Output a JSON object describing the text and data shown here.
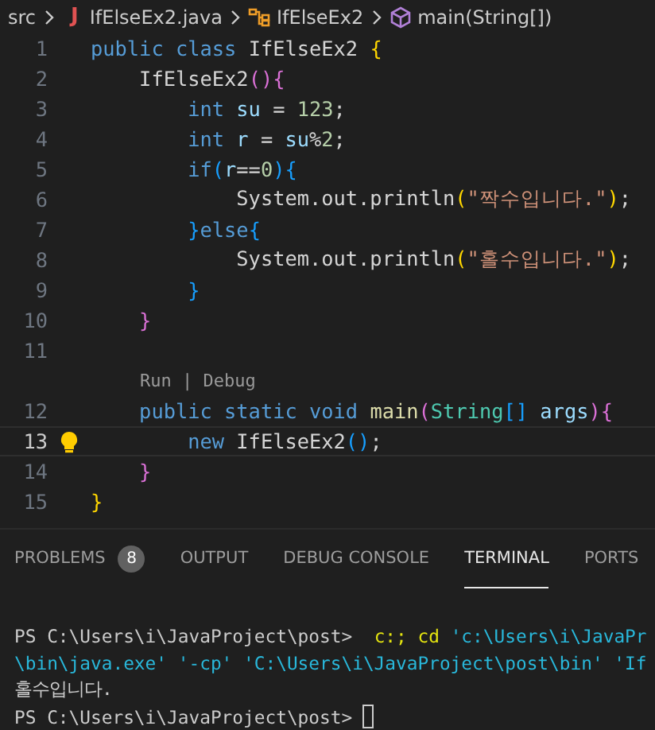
{
  "breadcrumb": {
    "folder": "src",
    "file_icon": "J",
    "file": "IfElseEx2.java",
    "class": "IfElseEx2",
    "method": "main(String[])"
  },
  "editor": {
    "lines": [
      {
        "number": "1",
        "current": false,
        "tokens": [
          {
            "text": "public",
            "kind": "kw"
          },
          {
            "text": " class",
            "kind": "kw"
          },
          {
            "text": " IfElseEx2 ",
            "kind": "plain"
          },
          {
            "text": "{",
            "kind": "b1"
          }
        ]
      },
      {
        "number": "2",
        "current": false,
        "tokens": [
          {
            "text": "    IfElseEx2",
            "kind": "plain"
          },
          {
            "text": "()",
            "kind": "b2"
          },
          {
            "text": "{",
            "kind": "b2"
          }
        ]
      },
      {
        "number": "3",
        "current": false,
        "tokens": [
          {
            "text": "        int",
            "kind": "kw"
          },
          {
            "text": " su ",
            "kind": "ident"
          },
          {
            "text": "= ",
            "kind": "plain"
          },
          {
            "text": "123",
            "kind": "num"
          },
          {
            "text": ";",
            "kind": "plain"
          }
        ]
      },
      {
        "number": "4",
        "current": false,
        "tokens": [
          {
            "text": "        int",
            "kind": "kw"
          },
          {
            "text": " r ",
            "kind": "ident"
          },
          {
            "text": "= ",
            "kind": "plain"
          },
          {
            "text": "su",
            "kind": "ident"
          },
          {
            "text": "%",
            "kind": "plain"
          },
          {
            "text": "2",
            "kind": "num"
          },
          {
            "text": ";",
            "kind": "plain"
          }
        ]
      },
      {
        "number": "5",
        "current": false,
        "tokens": [
          {
            "text": "        if",
            "kind": "kw"
          },
          {
            "text": "(",
            "kind": "b3"
          },
          {
            "text": "r",
            "kind": "ident"
          },
          {
            "text": "==",
            "kind": "plain"
          },
          {
            "text": "0",
            "kind": "num"
          },
          {
            "text": "){",
            "kind": "b3"
          }
        ]
      },
      {
        "number": "6",
        "current": false,
        "tokens": [
          {
            "text": "            System.out.println",
            "kind": "plain"
          },
          {
            "text": "(",
            "kind": "b1"
          },
          {
            "text": "\"짝수입니다.\"",
            "kind": "str"
          },
          {
            "text": ")",
            "kind": "b1"
          },
          {
            "text": ";",
            "kind": "plain"
          }
        ]
      },
      {
        "number": "7",
        "current": false,
        "tokens": [
          {
            "text": "        }",
            "kind": "b3"
          },
          {
            "text": "else",
            "kind": "kw"
          },
          {
            "text": "{",
            "kind": "b3"
          }
        ]
      },
      {
        "number": "8",
        "current": false,
        "tokens": [
          {
            "text": "            System.out.println",
            "kind": "plain"
          },
          {
            "text": "(",
            "kind": "b1"
          },
          {
            "text": "\"홀수입니다.\"",
            "kind": "str"
          },
          {
            "text": ")",
            "kind": "b1"
          },
          {
            "text": ";",
            "kind": "plain"
          }
        ]
      },
      {
        "number": "9",
        "current": false,
        "tokens": [
          {
            "text": "        }",
            "kind": "b3"
          }
        ]
      },
      {
        "number": "10",
        "current": false,
        "tokens": [
          {
            "text": "    }",
            "kind": "b2"
          }
        ]
      },
      {
        "number": "11",
        "current": false
      },
      {
        "number": "12",
        "current": false,
        "codelens": "Run | Debug",
        "tokens": [
          {
            "text": "    public",
            "kind": "kw"
          },
          {
            "text": " static",
            "kind": "kw"
          },
          {
            "text": " void",
            "kind": "kw"
          },
          {
            "text": " main",
            "kind": "fn"
          },
          {
            "text": "(",
            "kind": "b2"
          },
          {
            "text": "String",
            "kind": "type"
          },
          {
            "text": "[]",
            "kind": "b3"
          },
          {
            "text": " args",
            "kind": "ident"
          },
          {
            "text": "){",
            "kind": "b2"
          }
        ]
      },
      {
        "number": "13",
        "current": true,
        "lightbulb": true,
        "tokens": [
          {
            "text": "        new",
            "kind": "kw"
          },
          {
            "text": " IfElseEx2",
            "kind": "plain"
          },
          {
            "text": "()",
            "kind": "b3"
          },
          {
            "text": ";",
            "kind": "plain"
          }
        ]
      },
      {
        "number": "14",
        "current": false,
        "tokens": [
          {
            "text": "    }",
            "kind": "b2"
          }
        ]
      },
      {
        "number": "15",
        "current": false,
        "tokens": [
          {
            "text": "}",
            "kind": "b1"
          }
        ]
      }
    ]
  },
  "panel": {
    "tabs": [
      {
        "label": "PROBLEMS",
        "badge": "8",
        "selected": false
      },
      {
        "label": "OUTPUT",
        "selected": false
      },
      {
        "label": "DEBUG CONSOLE",
        "selected": false
      },
      {
        "label": "TERMINAL",
        "selected": true
      },
      {
        "label": "PORTS",
        "selected": false
      }
    ],
    "terminal": [
      {
        "segments": [
          {
            "text": "PS C:\\Users\\i\\JavaProject\\post>  ",
            "kind": "plain"
          },
          {
            "text": "c:; cd",
            "kind": "cmd"
          },
          {
            "text": " 'c:\\Users\\i\\JavaPr",
            "kind": "arg"
          }
        ]
      },
      {
        "segments": [
          {
            "text": "\\bin\\java.exe' '-cp' 'C:\\Users\\i\\JavaProject\\post\\bin' 'If",
            "kind": "arg"
          }
        ]
      },
      {
        "segments": [
          {
            "text": "홀수입니다.",
            "kind": "plain"
          }
        ]
      },
      {
        "segments": [
          {
            "text": "PS C:\\Users\\i\\JavaProject\\post> ",
            "kind": "plain"
          }
        ],
        "cursor": true
      }
    ]
  }
}
